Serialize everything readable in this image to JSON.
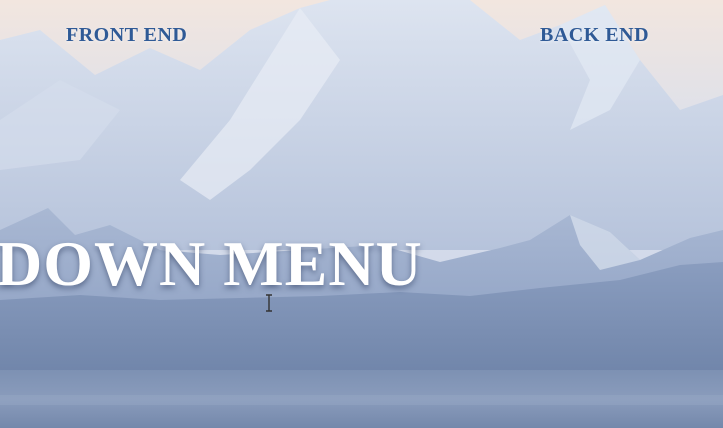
{
  "nav": {
    "front_end_label": "FRONT END",
    "back_end_label": "BACK END"
  },
  "hero": {
    "headline": "DOWN MENU"
  },
  "colors": {
    "nav_text": "#2f5a96",
    "headline_text": "#ffffff",
    "sky_top": "#f2e6df",
    "sky_bottom": "#c9d3e6",
    "far_mountain": "#c2cee3",
    "near_mountain": "#7f93b5",
    "lake": "#7a8fb2"
  },
  "icons": {
    "cursor": "text-cursor-icon"
  }
}
